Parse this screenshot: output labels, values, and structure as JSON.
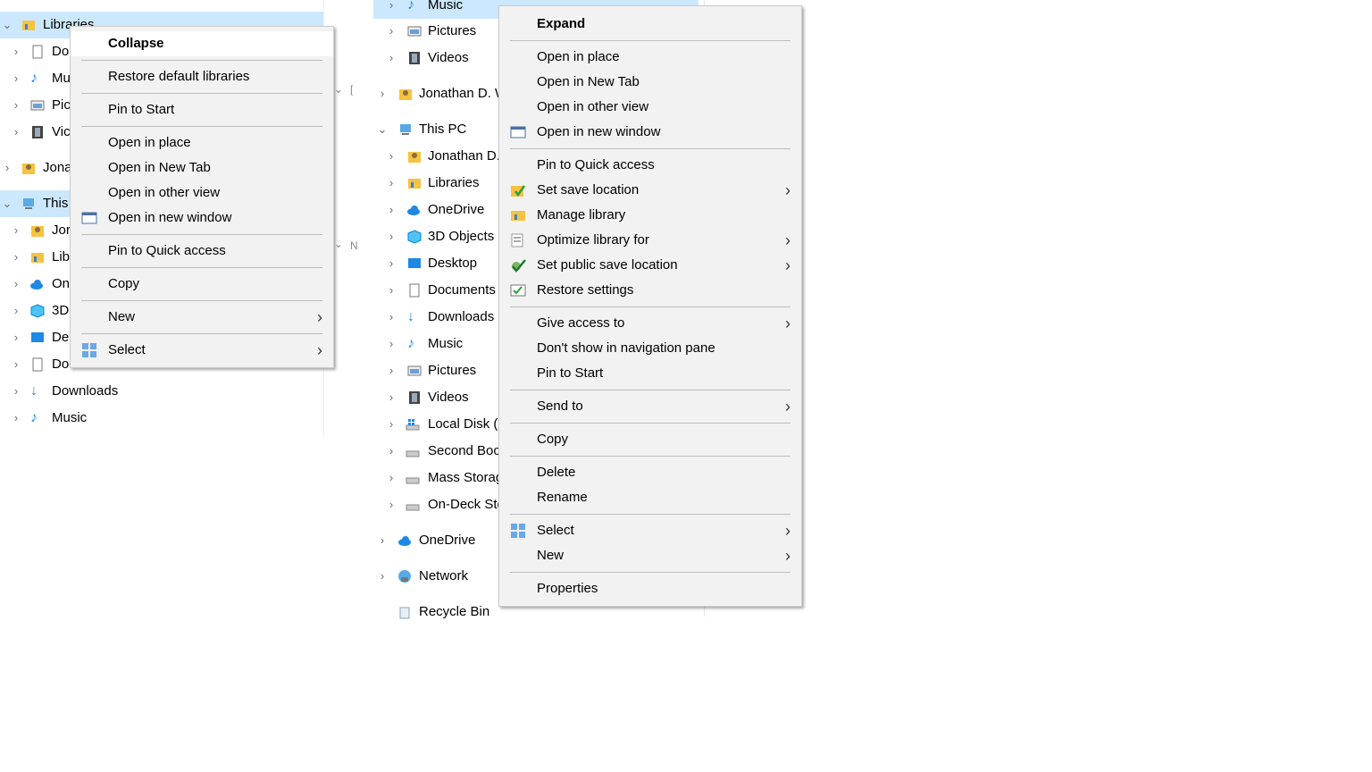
{
  "left_pane": {
    "items": [
      {
        "label": "Libraries",
        "chevron": "down"
      },
      {
        "label": "Do",
        "chevron": "right"
      },
      {
        "label": "Mu",
        "chevron": "right"
      },
      {
        "label": "Pic",
        "chevron": "right"
      },
      {
        "label": "Vic",
        "chevron": "right"
      },
      {
        "label": "Jona",
        "chevron": "right"
      },
      {
        "label": "This",
        "chevron": "down"
      },
      {
        "label": "Jor",
        "chevron": "right"
      },
      {
        "label": "Lib",
        "chevron": "right"
      },
      {
        "label": "On",
        "chevron": "right"
      },
      {
        "label": "3D",
        "chevron": "right"
      },
      {
        "label": "De",
        "chevron": "right"
      },
      {
        "label": "Documents",
        "chevron": "right"
      },
      {
        "label": "Downloads",
        "chevron": "right"
      },
      {
        "label": "Music",
        "chevron": "right"
      }
    ]
  },
  "right_pane": {
    "items": [
      {
        "label": "Music",
        "chevron": "down"
      },
      {
        "label": "Pictures",
        "chevron": "right"
      },
      {
        "label": "Videos",
        "chevron": "right"
      },
      {
        "label": "Jonathan D. W",
        "chevron": "right"
      },
      {
        "label": "This PC",
        "chevron": "down"
      },
      {
        "label": "Jonathan D.",
        "chevron": "right"
      },
      {
        "label": "Libraries",
        "chevron": "right"
      },
      {
        "label": "OneDrive",
        "chevron": "right"
      },
      {
        "label": "3D Objects",
        "chevron": "right"
      },
      {
        "label": "Desktop",
        "chevron": "right"
      },
      {
        "label": "Documents",
        "chevron": "right"
      },
      {
        "label": "Downloads",
        "chevron": "right"
      },
      {
        "label": "Music",
        "chevron": "right"
      },
      {
        "label": "Pictures",
        "chevron": "right"
      },
      {
        "label": "Videos",
        "chevron": "right"
      },
      {
        "label": "Local Disk (C",
        "chevron": "right"
      },
      {
        "label": "Second Boo",
        "chevron": "right"
      },
      {
        "label": "Mass Storag",
        "chevron": "right"
      },
      {
        "label": "On-Deck Sto",
        "chevron": "right"
      },
      {
        "label": "OneDrive",
        "chevron": "right"
      },
      {
        "label": "Network",
        "chevron": "right"
      },
      {
        "label": "Recycle Bin",
        "chevron": ""
      }
    ],
    "stray_fragments": [
      "[",
      "N"
    ]
  },
  "menu_left": {
    "items": [
      {
        "label": "Collapse",
        "bold": true
      },
      {
        "label": "Restore default libraries"
      },
      {
        "label": "Pin to Start"
      },
      {
        "label": "Open in place"
      },
      {
        "label": "Open in New Tab"
      },
      {
        "label": "Open in other view"
      },
      {
        "label": "Open in new window",
        "icon": "window-icon"
      },
      {
        "label": "Pin to Quick access"
      },
      {
        "label": "Copy"
      },
      {
        "label": "New",
        "submenu": true
      },
      {
        "label": "Select",
        "icon": "select-grid-icon",
        "submenu": true
      }
    ]
  },
  "menu_right": {
    "items": [
      {
        "label": "Expand",
        "bold": true
      },
      {
        "label": "Open in place"
      },
      {
        "label": "Open in New Tab"
      },
      {
        "label": "Open in other view"
      },
      {
        "label": "Open in new window",
        "icon": "window-icon"
      },
      {
        "label": "Pin to Quick access"
      },
      {
        "label": "Set save location",
        "icon": "folder-check-icon",
        "submenu": true
      },
      {
        "label": "Manage library",
        "icon": "library-icon"
      },
      {
        "label": "Optimize library for",
        "icon": "optimize-icon",
        "submenu": true
      },
      {
        "label": "Set public save location",
        "icon": "public-check-icon",
        "submenu": true
      },
      {
        "label": "Restore settings",
        "icon": "restore-settings-icon"
      },
      {
        "label": "Give access to",
        "submenu": true
      },
      {
        "label": "Don't show in navigation pane"
      },
      {
        "label": "Pin to Start"
      },
      {
        "label": "Send to",
        "submenu": true
      },
      {
        "label": "Copy"
      },
      {
        "label": "Delete"
      },
      {
        "label": "Rename"
      },
      {
        "label": "Select",
        "icon": "select-grid-icon",
        "submenu": true
      },
      {
        "label": "New",
        "submenu": true
      },
      {
        "label": "Properties"
      }
    ]
  },
  "colors": {
    "selection": "#cce8ff",
    "menu_bg": "#f2f2f2",
    "accent_blue": "#1e88e5",
    "folder_yellow": "#f5c342"
  }
}
